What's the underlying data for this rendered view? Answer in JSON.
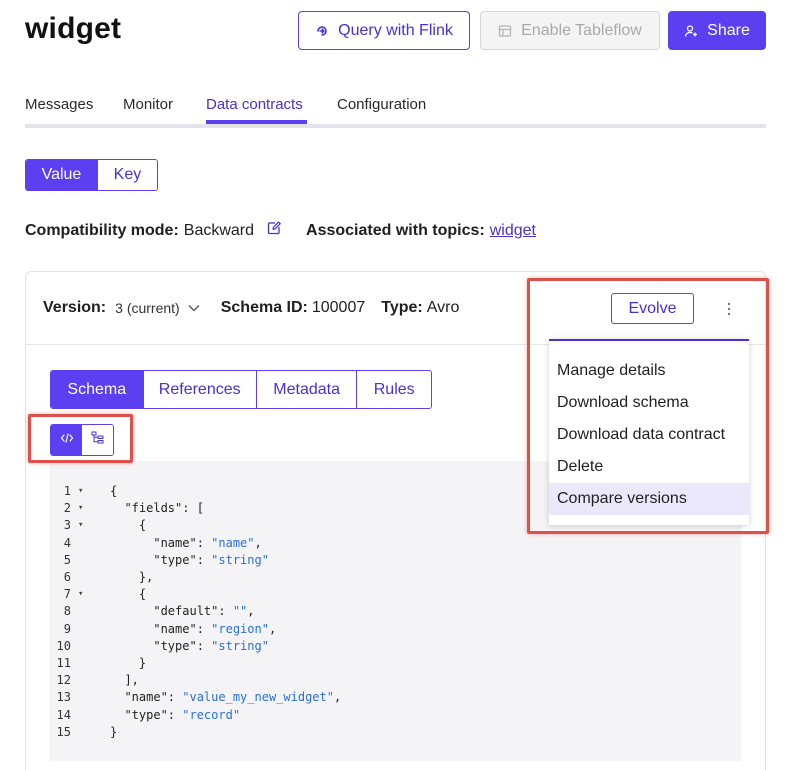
{
  "page_title": "widget",
  "header_buttons": {
    "query_flink": "Query with Flink",
    "enable_tableflow": "Enable Tableflow",
    "share": "Share"
  },
  "tabs": [
    {
      "label": "Messages"
    },
    {
      "label": "Monitor"
    },
    {
      "label": "Data contracts",
      "active": true
    },
    {
      "label": "Configuration"
    }
  ],
  "subject_toggle": {
    "value": "Value",
    "key": "Key",
    "selected": "Value"
  },
  "compatibility": {
    "label": "Compatibility mode:",
    "value": "Backward"
  },
  "associated": {
    "label": "Associated with topics:",
    "topic": "widget"
  },
  "version_bar": {
    "version_label": "Version:",
    "version_value": "3 (current)",
    "schema_id_label": "Schema ID:",
    "schema_id_value": "100007",
    "type_label": "Type:",
    "type_value": "Avro",
    "evolve": "Evolve"
  },
  "schema_tabs": [
    {
      "label": "Schema",
      "active": true
    },
    {
      "label": "References"
    },
    {
      "label": "Metadata"
    },
    {
      "label": "Rules"
    }
  ],
  "code_lines": [
    {
      "n": "1",
      "fold": true,
      "text": "{"
    },
    {
      "n": "2",
      "fold": true,
      "text": "  \"fields\": ["
    },
    {
      "n": "3",
      "fold": true,
      "text": "    {"
    },
    {
      "n": "4",
      "fold": false,
      "text": "      \"name\": ",
      "str": "\"name\"",
      "tail": ","
    },
    {
      "n": "5",
      "fold": false,
      "text": "      \"type\": ",
      "str": "\"string\"",
      "tail": ""
    },
    {
      "n": "6",
      "fold": false,
      "text": "    },"
    },
    {
      "n": "7",
      "fold": true,
      "text": "    {"
    },
    {
      "n": "8",
      "fold": false,
      "text": "      \"default\": ",
      "str": "\"\"",
      "tail": ","
    },
    {
      "n": "9",
      "fold": false,
      "text": "      \"name\": ",
      "str": "\"region\"",
      "tail": ","
    },
    {
      "n": "10",
      "fold": false,
      "text": "      \"type\": ",
      "str": "\"string\"",
      "tail": ""
    },
    {
      "n": "11",
      "fold": false,
      "text": "    }"
    },
    {
      "n": "12",
      "fold": false,
      "text": "  ],"
    },
    {
      "n": "13",
      "fold": false,
      "text": "  \"name\": ",
      "str": "\"value_my_new_widget\"",
      "tail": ","
    },
    {
      "n": "14",
      "fold": false,
      "text": "  \"type\": ",
      "str": "\"record\"",
      "tail": ""
    },
    {
      "n": "15",
      "fold": false,
      "text": "}"
    }
  ],
  "kebab_menu": [
    {
      "label": "Manage details"
    },
    {
      "label": "Download schema"
    },
    {
      "label": "Download data contract"
    },
    {
      "label": "Delete"
    },
    {
      "label": "Compare versions",
      "hovered": true
    }
  ],
  "colors": {
    "accent": "#5b3ff0",
    "highlight_box": "#e0504a",
    "menu_hover": "#ece8fb",
    "code_bg": "#f4f4f6",
    "code_string": "#2a6fd6"
  },
  "icons": {
    "query_flink": "flink-query-icon",
    "enable_tableflow": "tableflow-icon",
    "share": "add-user-icon",
    "edit_compat": "edit-icon",
    "version_dropdown": "chevron-down-icon",
    "kebab": "vertical-dots-icon",
    "code_view": "code-view-icon",
    "tree_view": "tree-view-icon",
    "fold": "caret-down-icon"
  }
}
